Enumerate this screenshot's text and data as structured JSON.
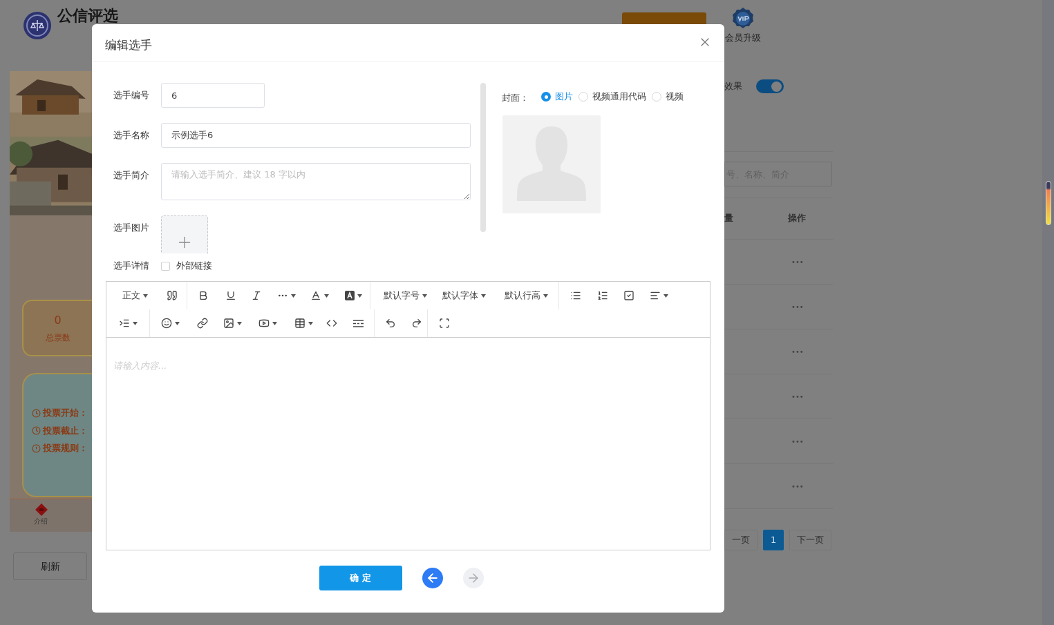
{
  "header": {
    "logo_text": "公信评选",
    "vip_label": "会员升级"
  },
  "preview": {
    "votes": {
      "value": "0",
      "label": "总票数"
    },
    "info": [
      "投票开始：",
      "投票截止：",
      "投票规则："
    ],
    "nav_label": "介绍"
  },
  "refresh_button": "刷新",
  "effect": {
    "label": "效果",
    "on": true
  },
  "search": {
    "placeholder": "号、名称、简介"
  },
  "table": {
    "columns": [
      "量",
      "操作"
    ],
    "rows": [
      {
        "action": "•••"
      },
      {
        "action": "•••"
      },
      {
        "action": "•••"
      },
      {
        "action": "•••"
      },
      {
        "action": "•••"
      },
      {
        "action": "•••"
      }
    ]
  },
  "pagination": [
    {
      "label": "一页",
      "selected": false
    },
    {
      "label": "1",
      "selected": true
    },
    {
      "label": "下一页",
      "selected": false
    }
  ],
  "dialog": {
    "title": "编辑选手",
    "fields": [
      {
        "label": "选手编号",
        "kind": "short-input",
        "value": "6"
      },
      {
        "label": "选手名称",
        "kind": "input",
        "value": "示例选手6"
      },
      {
        "label": "选手简介",
        "kind": "textarea",
        "placeholder": "请输入选手简介、建议 18 字以内"
      },
      {
        "label": "选手图片",
        "kind": "upload"
      }
    ],
    "detail": {
      "label": "选手详情",
      "link": {
        "label": "外部链接",
        "checked": false
      }
    },
    "cover": {
      "label": "封面：",
      "options": [
        {
          "label": "图片",
          "selected": true
        },
        {
          "label": "视频通用代码",
          "selected": false
        },
        {
          "label": "视频",
          "selected": false
        }
      ]
    },
    "editor": {
      "toolbar_labels": [
        "正文",
        "默认字号",
        "默认字体",
        "默认行高"
      ],
      "placeholder": "请输入内容..."
    },
    "confirm": "确 定",
    "prev": {
      "disabled": false
    },
    "next": {
      "disabled": true
    }
  }
}
